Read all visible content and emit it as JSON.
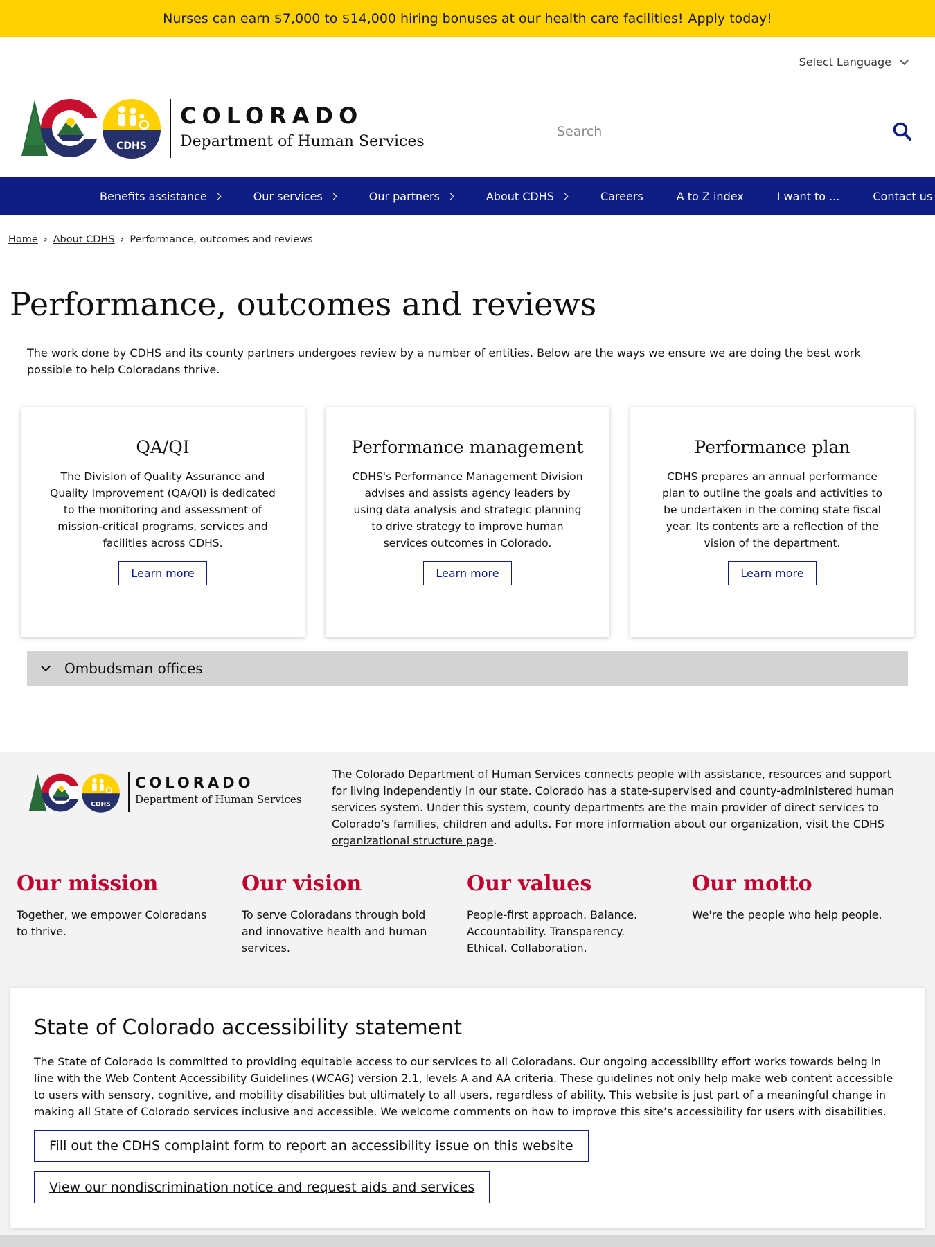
{
  "alert": {
    "text": "Nurses can earn $7,000 to $14,000 hiring bonuses at our health care facilities!",
    "link": "Apply today",
    "suffix": "!"
  },
  "language": {
    "label": "Select Language"
  },
  "logo": {
    "state": "COLORADO",
    "department": "Department of Human Services",
    "badge": "CDHS"
  },
  "search": {
    "placeholder": "Search"
  },
  "nav": {
    "items": [
      {
        "label": "Benefits assistance"
      },
      {
        "label": "Our services"
      },
      {
        "label": "Our partners"
      },
      {
        "label": "About CDHS"
      },
      {
        "label": "Careers"
      },
      {
        "label": "A to Z index"
      },
      {
        "label": "I want to ..."
      },
      {
        "label": "Contact us"
      }
    ]
  },
  "breadcrumb": {
    "home": "Home",
    "parent": "About CDHS",
    "current": "Performance, outcomes and reviews"
  },
  "page": {
    "title": "Performance, outcomes and reviews",
    "intro": "The work done by CDHS and its county partners undergoes review by a number of entities. Below are the ways we ensure we are doing the best work possible to help Coloradans thrive."
  },
  "cards": [
    {
      "title": "QA/QI",
      "body": "The Division of Quality Assurance and Quality Improvement (QA/QI) is dedicated to the monitoring and assessment of mission-critical programs, services and facilities across CDHS.",
      "button": "Learn more"
    },
    {
      "title": "Performance management",
      "body": "CDHS's Performance Management Division advises and assists agency leaders by using data analysis and strategic planning to drive strategy to improve human services outcomes in Colorado.",
      "button": "Learn more"
    },
    {
      "title": "Performance plan",
      "body": "CDHS prepares an annual performance plan to outline the goals and activities to be undertaken in the coming state fiscal year. Its contents are a reflection of the vision of the department.",
      "button": "Learn more"
    }
  ],
  "accordion": {
    "label": "Ombudsman offices"
  },
  "footer": {
    "about": "The Colorado Department of Human Services connects people with assistance, resources and support for living independently in our state. Colorado has a state-supervised and county-administered human services system. Under this system, county departments are the main provider of direct services to Colorado’s families, children and adults. For more information about our organization, visit the",
    "about_link": "CDHS organizational structure page",
    "about_end": ".",
    "values": [
      {
        "title": "Our mission",
        "body": "Together, we empower Coloradans to thrive."
      },
      {
        "title": "Our vision",
        "body": "To serve Coloradans through bold and innovative health and human services."
      },
      {
        "title": "Our values",
        "body": "People-first approach. Balance. Accountability. Transparency. Ethical. Collaboration."
      },
      {
        "title": "Our motto",
        "body": "We're the people who help people."
      }
    ],
    "accessibility": {
      "title": "State of Colorado accessibility statement",
      "body": "The State of Colorado is committed to providing equitable access to our services to all Coloradans. Our ongoing accessibility effort works towards being in line with the Web Content Accessibility Guidelines (WCAG) version 2.1, levels A and AA criteria. These guidelines not only help make web content accessible to users with sensory, cognitive, and mobility disabilities but ultimately to all users, regardless of ability. This website is just part of a meaningful change in making all State of Colorado services inclusive and accessible. We welcome comments on how to improve this site’s accessibility for users with disabilities.",
      "button1": "Fill out the CDHS complaint form to report an accessibility issue on this website",
      "button2": "View our nondiscrimination notice and request aids and services"
    }
  },
  "colors": {
    "alert": "#ffd100",
    "nav": "#0e1e84",
    "accent_red": "#c0002e",
    "footer_bg": "#f3f3f3"
  },
  "icons": [
    "colorado-c-logo-icon",
    "cdhs-family-badge-icon",
    "search-icon",
    "chevron-down-icon",
    "chevron-right-icon"
  ]
}
